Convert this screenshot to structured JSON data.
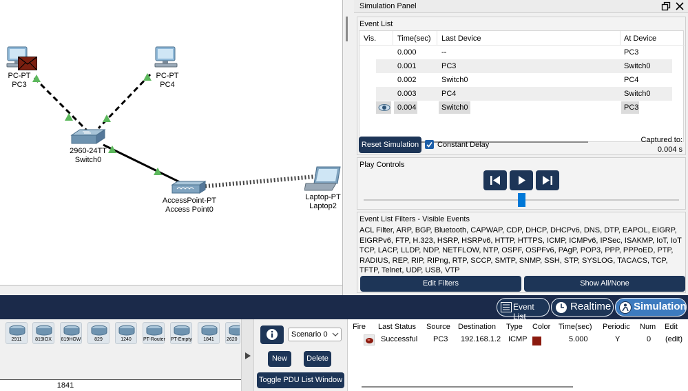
{
  "workspace": {
    "devices": [
      {
        "type": "PC-PT",
        "name": "PC3"
      },
      {
        "type": "PC-PT",
        "name": "PC4"
      },
      {
        "type": "2960-24TT",
        "name": "Switch0"
      },
      {
        "type": "AccessPoint-PT",
        "name": "Access Point0"
      },
      {
        "type": "Laptop-PT",
        "name": "Laptop2"
      }
    ]
  },
  "sim_panel": {
    "title": "Simulation Panel",
    "event_list_title": "Event List",
    "columns": [
      "Vis.",
      "Time(sec)",
      "Last Device",
      "At Device"
    ],
    "rows": [
      {
        "time": "0.000",
        "last": "--",
        "at": "PC3"
      },
      {
        "time": "0.001",
        "last": "PC3",
        "at": "Switch0"
      },
      {
        "time": "0.002",
        "last": "Switch0",
        "at": "PC4"
      },
      {
        "time": "0.003",
        "last": "PC4",
        "at": "Switch0"
      },
      {
        "time": "0.004",
        "last": "Switch0",
        "at": "PC3"
      }
    ],
    "reset_label": "Reset Simulation",
    "constant_delay_label": "Constant Delay",
    "constant_delay_checked": true,
    "captured_label": "Captured to:",
    "captured_value": "0.004 s",
    "play_controls_title": "Play Controls",
    "filters_title": "Event List Filters - Visible Events",
    "filters_text": "ACL Filter, ARP, BGP, Bluetooth, CAPWAP, CDP, DHCP, DHCPv6, DNS, DTP, EAPOL, EIGRP, EIGRPv6, FTP, H.323, HSRP, HSRPv6, HTTP, HTTPS, ICMP, ICMPv6, IPSec, ISAKMP, IoT, IoT TCP, LACP, LLDP, NDP, NETFLOW, NTP, OSPF, OSPFv6, PAgP, POP3, PPP, PPPoED, PTP, RADIUS, REP, RIP, RIPng, RTP, SCCP, SMTP, SNMP, SSH, STP, SYSLOG, TACACS, TCP, TFTP, Telnet, UDP, USB, VTP",
    "edit_filters_label": "Edit Filters",
    "show_all_label": "Show All/None"
  },
  "mode_bar": {
    "event_list": "Event List",
    "realtime": "Realtime",
    "simulation": "Simulation"
  },
  "device_strip": {
    "tiles": [
      "2911",
      "819IOX",
      "819HGW",
      "829",
      "1240",
      "PT-Router",
      "PT-Empty",
      "1841",
      "2620"
    ],
    "selected_name": "1841"
  },
  "scenario": {
    "select_value": "Scenario 0",
    "new_label": "New",
    "delete_label": "Delete",
    "toggle_label": "Toggle PDU List Window"
  },
  "pdu": {
    "columns": [
      "Fire",
      "Last Status",
      "Source",
      "Destination",
      "Type",
      "Color",
      "Time(sec)",
      "Periodic",
      "Num",
      "Edit"
    ],
    "rows": [
      {
        "status": "Successful",
        "source": "PC3",
        "destination": "192.168.1.2",
        "type": "ICMP",
        "color": "#8b1a0e",
        "time": "5.000",
        "periodic": "Y",
        "num": "0",
        "edit": "(edit)"
      }
    ]
  }
}
